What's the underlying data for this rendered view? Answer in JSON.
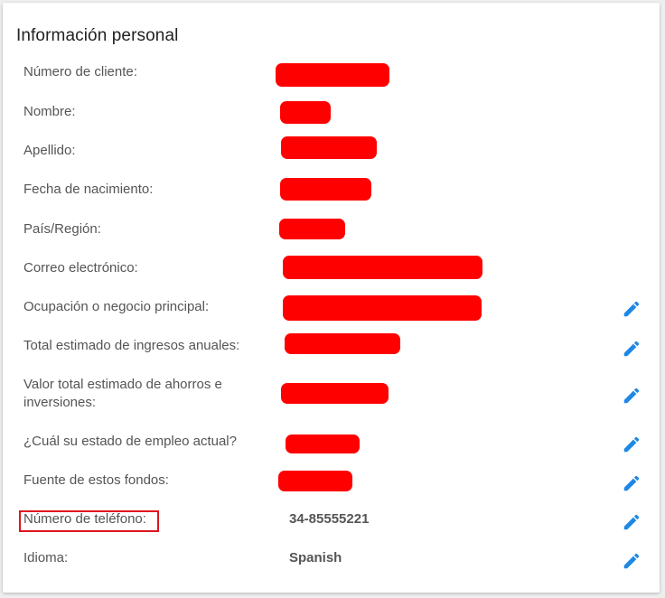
{
  "section": {
    "title": "Información personal"
  },
  "fields": [
    {
      "label": "Número de cliente:",
      "value": null
    },
    {
      "label": "Nombre:",
      "value": null
    },
    {
      "label": "Apellido:",
      "value": null
    },
    {
      "label": "Fecha de nacimiento:",
      "value": null
    },
    {
      "label": "País/Región:",
      "value": null
    },
    {
      "label": "Correo electrónico:",
      "value": null
    },
    {
      "label": "Ocupación o negocio principal:",
      "value": null
    },
    {
      "label": "Total estimado de ingresos anuales:",
      "value": null
    },
    {
      "label": "Valor total estimado de ahorros e inversiones:",
      "value": null
    },
    {
      "label": "¿Cuál su estado de empleo actual?",
      "value": null
    },
    {
      "label": "Fuente de estos fondos:",
      "value": null
    },
    {
      "label": "Número de teléfono:",
      "value": "34-85555221"
    },
    {
      "label": "Idioma:",
      "value": "Spanish"
    }
  ],
  "icons": {
    "edit": "pencil-icon"
  },
  "colors": {
    "redaction": "#ff0000",
    "edit_icon": "#1e88e5",
    "highlight_border": "#e0141e"
  }
}
